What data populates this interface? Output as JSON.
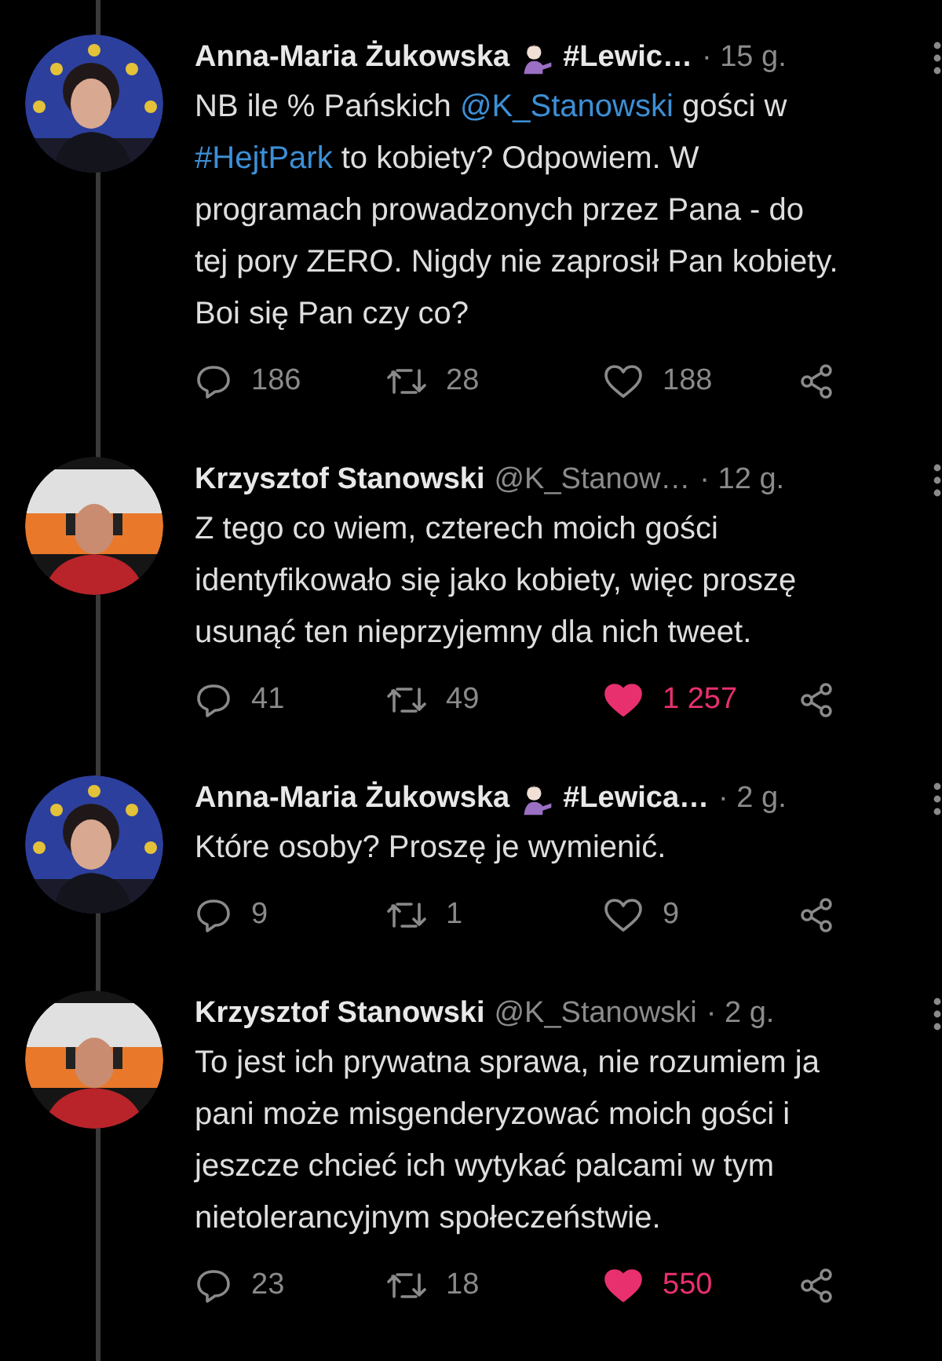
{
  "tweets": [
    {
      "name": "Anna-Maria Żukowska",
      "emoji": true,
      "suffix": "#Lewic…",
      "time": "· 15 g.",
      "body": [
        {
          "kind": "plain",
          "text": "NB ile % Pańskich "
        },
        {
          "kind": "link",
          "text": "@K_Stanowski"
        },
        {
          "kind": "plain",
          "text": " gości w\n"
        },
        {
          "kind": "link",
          "text": "#HejtPark"
        },
        {
          "kind": "plain",
          "text": " to kobiety? Odpowiem. W\nprogramach prowadzonych przez Pana - do\ntej pory ZERO. Nigdy nie zaprosił Pan kobiety.\nBoi się Pan czy co?"
        }
      ],
      "replies": "186",
      "retweets": "28",
      "likes": "188",
      "liked": false
    },
    {
      "name": "Krzysztof Stanowski",
      "emoji": false,
      "handle": "@K_Stanow…",
      "time": "· 12 g.",
      "body": [
        {
          "kind": "plain",
          "text": "Z tego co wiem, czterech moich gości\nidentyfikowało się jako kobiety, więc proszę\nusunąć ten nieprzyjemny dla nich tweet."
        }
      ],
      "replies": "41",
      "retweets": "49",
      "likes": "1 257",
      "liked": true
    },
    {
      "name": "Anna-Maria Żukowska",
      "emoji": true,
      "suffix": "#Lewica…",
      "time": "· 2 g.",
      "body": [
        {
          "kind": "plain",
          "text": "Które osoby? Proszę je wymienić."
        }
      ],
      "replies": "9",
      "retweets": "1",
      "likes": "9",
      "liked": false
    },
    {
      "name": "Krzysztof Stanowski",
      "emoji": false,
      "handle": "@K_Stanowski",
      "time": "· 2 g.",
      "body": [
        {
          "kind": "plain",
          "text": "To jest ich prywatna sprawa, nie rozumiem ja\npani może misgenderyzować moich gości i\njeszcze chcieć ich wytykać palcami w tym\nnietolerancyjnym społeczeństwie."
        }
      ],
      "replies": "23",
      "retweets": "18",
      "likes": "550",
      "liked": true
    }
  ]
}
